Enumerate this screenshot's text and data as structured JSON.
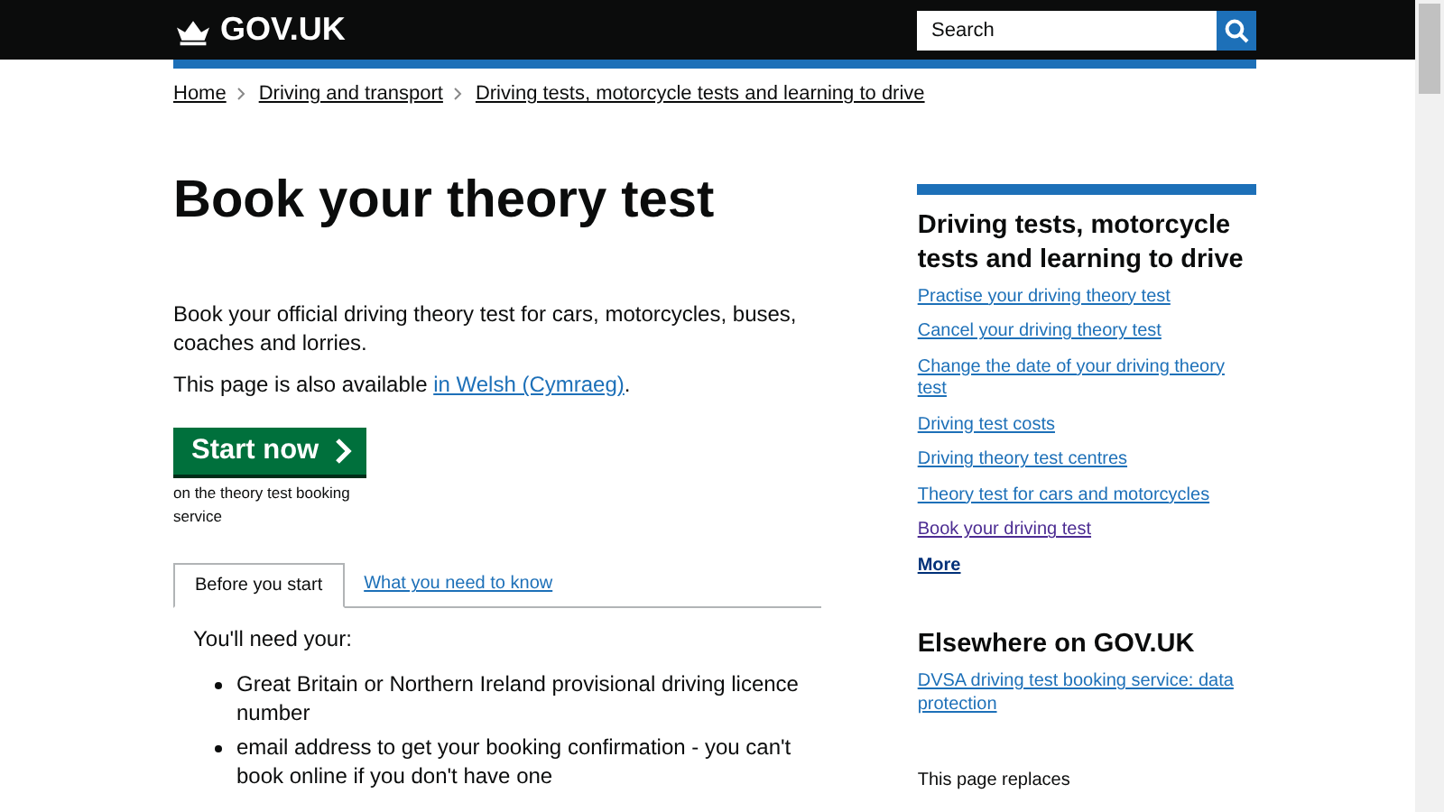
{
  "header": {
    "logo": "GOV.UK",
    "search": {
      "placeholder": "Search"
    }
  },
  "breadcrumbs": [
    "Home",
    "Driving and transport",
    "Driving tests, motorcycle tests and learning to drive"
  ],
  "title": "Book your theory test",
  "intro": "Book your official driving theory test for cars, motorcycles, buses, coaches and lorries.",
  "welsh": {
    "text": "This page is also available ",
    "link": "in Welsh (Cymraeg)",
    "after": "."
  },
  "start_button": {
    "label": "Start now",
    "note": "on the theory test booking service"
  },
  "tabs": [
    {
      "label": "Before you start",
      "selected": true
    },
    {
      "label": "What you need to know",
      "selected": false
    }
  ],
  "tab_panel": {
    "lead": "You'll need your:",
    "items": [
      "Great Britain or Northern Ireland provisional driving licence number",
      "email address to get your booking confirmation - you can't book online if you don't have one"
    ]
  },
  "related": {
    "heading": "Driving tests, motorcycle tests and learning to drive",
    "links": [
      {
        "label": "Practise your driving theory test",
        "visited": false
      },
      {
        "label": "Cancel your driving theory test",
        "visited": false
      },
      {
        "label": "Change the date of your driving theory test",
        "visited": false
      },
      {
        "label": "Driving test costs",
        "visited": false
      },
      {
        "label": "Driving theory test centres",
        "visited": false
      },
      {
        "label": "Theory test for cars and motorcycles",
        "visited": false
      },
      {
        "label": "Book your driving test",
        "visited": true
      }
    ],
    "more": "More"
  },
  "elsewhere": {
    "heading": "Elsewhere on GOV.UK",
    "links": [
      "DVSA driving test booking service: data protection"
    ]
  },
  "replaces": "This page replaces"
}
